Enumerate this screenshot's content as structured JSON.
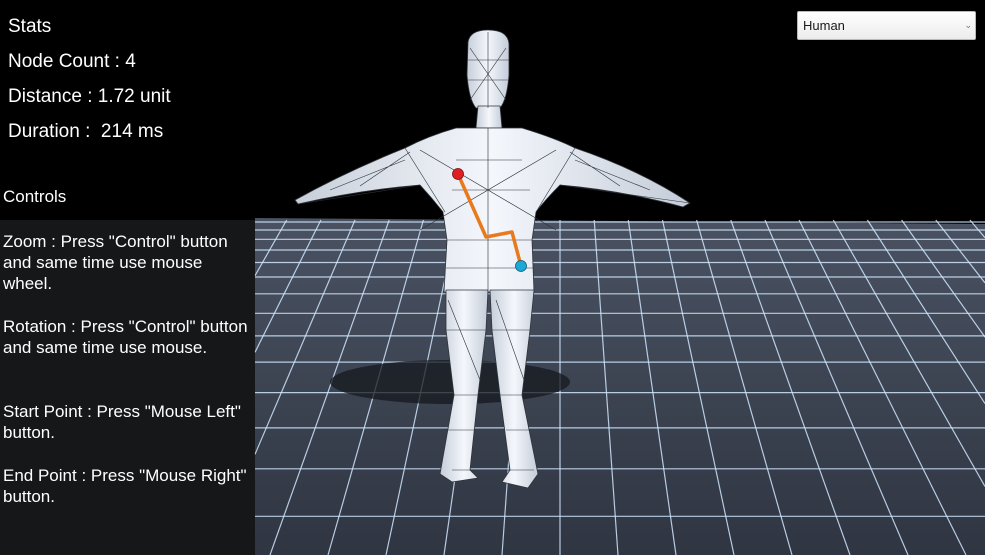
{
  "stats": {
    "title": "Stats",
    "node_count": "Node Count : 4",
    "distance": "Distance : 1.72 unit",
    "duration": "Duration :  214 ms"
  },
  "controls": {
    "title": "Controls",
    "items": [
      "Zoom : Press \"Control\" button and same time use mouse wheel.",
      "Rotation : Press \"Control\" button and same time use mouse.",
      "Start Point : Press \"Mouse Left\" button.",
      "End Point : Press \"Mouse Right\" button."
    ]
  },
  "model_select": {
    "value": "Human"
  },
  "scene": {
    "grid_color": "#cfe6ff",
    "floor_color": "#3b4250",
    "model_color": "#e9eef7",
    "path_color": "#e87a1c",
    "start_marker_color": "#e02020",
    "end_marker_color": "#1ca9d8"
  }
}
